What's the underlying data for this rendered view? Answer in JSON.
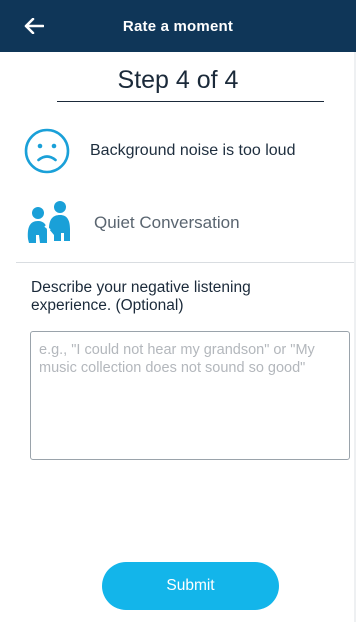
{
  "header": {
    "title": "Rate a moment",
    "back_icon": "arrow-left-icon"
  },
  "step": {
    "label": "Step 4 of 4"
  },
  "rating": {
    "icon": "sad-face-icon",
    "label": "Background noise is too loud"
  },
  "situation": {
    "icon": "conversation-people-icon",
    "label": "Quiet Conversation"
  },
  "feedback": {
    "prompt": "Describe your negative listening experience. (Optional)",
    "placeholder": "e.g., \"I could not hear my grandson\" or \"My music collection does not sound so good\""
  },
  "actions": {
    "submit_label": "Submit"
  },
  "colors": {
    "header_bg": "#0f3658",
    "accent": "#13b5ea",
    "icon_blue": "#1aa0d8"
  }
}
